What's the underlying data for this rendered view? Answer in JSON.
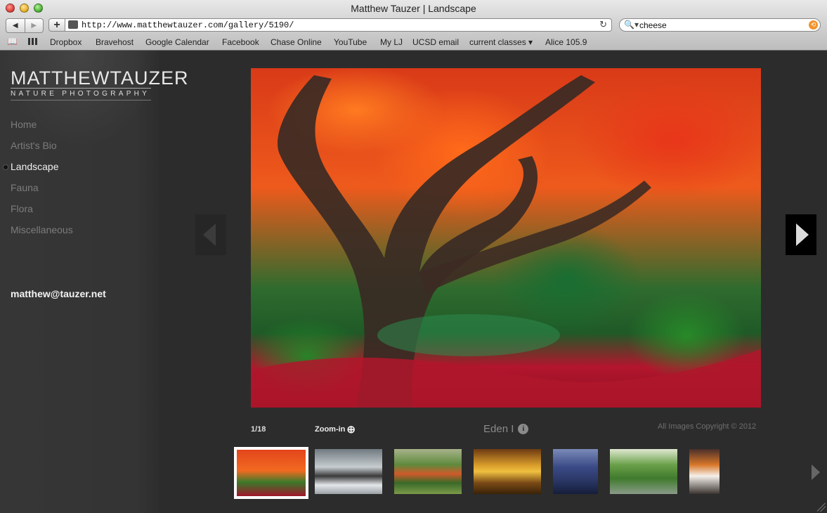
{
  "window": {
    "title": "Matthew Tauzer | Landscape"
  },
  "toolbar": {
    "back_glyph": "◀",
    "forward_glyph": "▶",
    "add_glyph": "+",
    "url": "http://www.matthewtauzer.com/gallery/5190/",
    "reload_glyph": "↻",
    "search_value": "cheese",
    "search_icon_glyph": "🔍▾"
  },
  "bookmarks": [
    "Dropbox",
    "Bravehost",
    "Google Calendar",
    "Facebook",
    "Chase Online",
    "YouTube",
    "My LJ",
    "UCSD email",
    "current classes ▾",
    "Alice 105.9"
  ],
  "site": {
    "logo_main": "MATTHEWTAUZER",
    "logo_sub": "NATURE PHOTOGRAPHY",
    "menu": [
      "Home",
      "Artist's Bio",
      "Landscape",
      "Fauna",
      "Flora",
      "Miscellaneous"
    ],
    "active_menu": "Landscape",
    "email": "matthew@tauzer.net"
  },
  "gallery": {
    "counter": "1/18",
    "zoom_label": "Zoom-in",
    "photo_title": "Eden I",
    "info_glyph": "i",
    "copyright": "All Images Copyright © 2012",
    "thumbnail_count": 7,
    "active_thumbnail": 1
  }
}
